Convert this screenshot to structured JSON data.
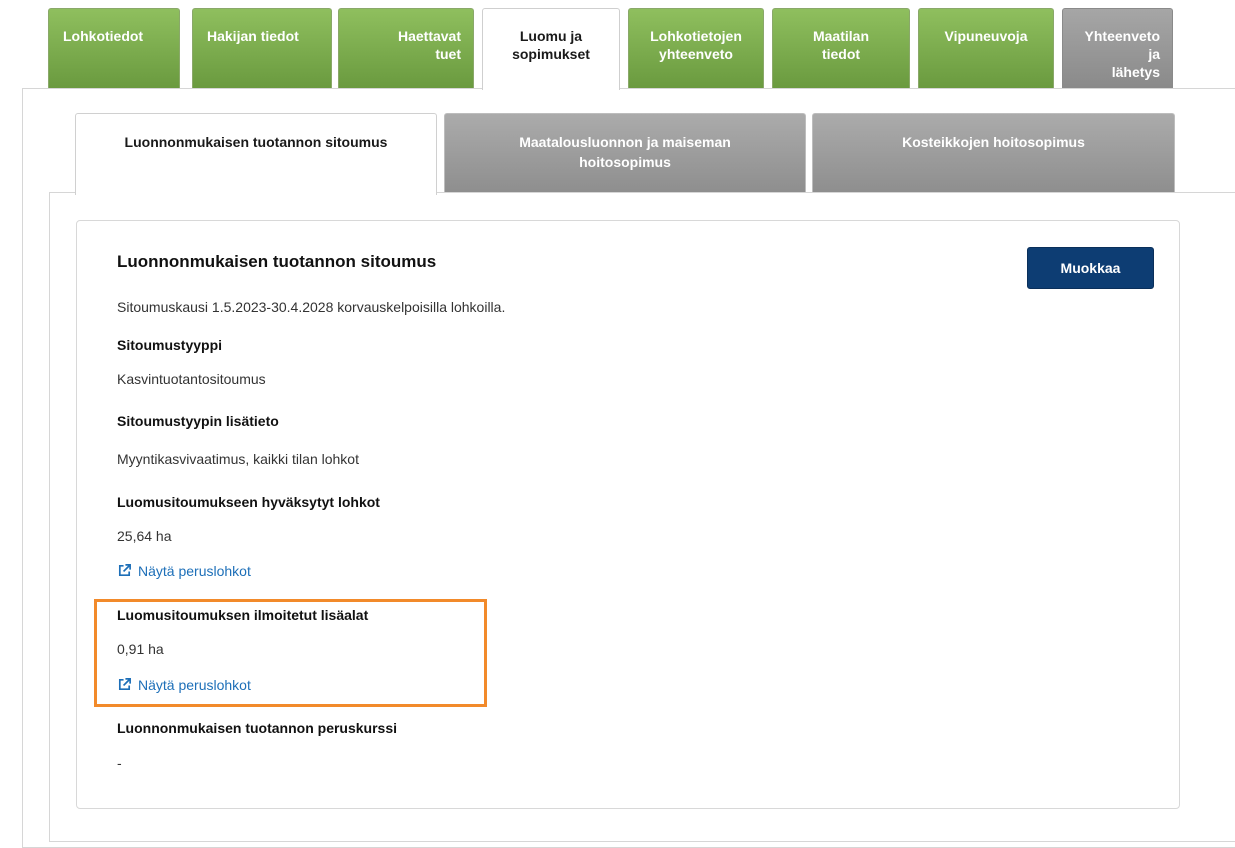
{
  "top_tabs": [
    {
      "label": "Lohkotiedot"
    },
    {
      "label": "Hakijan tiedot"
    },
    {
      "label_line1": "Haettavat",
      "label_line2": "tuet"
    },
    {
      "label_line1": "Luomu ja",
      "label_line2": "sopimukset"
    },
    {
      "label_line1": "Lohkotietojen",
      "label_line2": "yhteenveto"
    },
    {
      "label_line1": "Maatilan",
      "label_line2": "tiedot"
    },
    {
      "label": "Vipuneuvoja"
    },
    {
      "label_line1": "Yhteenveto ja",
      "label_line2": "lähetys"
    }
  ],
  "sub_tabs": [
    {
      "label": "Luonnonmukaisen tuotannon sitoumus"
    },
    {
      "label_line1": "Maatalousluonnon ja maiseman",
      "label_line2": "hoitosopimus"
    },
    {
      "label": "Kosteikkojen hoitosopimus"
    }
  ],
  "card": {
    "title": "Luonnonmukaisen tuotannon sitoumus",
    "edit_label": "Muokkaa",
    "period_text": "Sitoumuskausi 1.5.2023-30.4.2028 korvauskelpoisilla lohkoilla.",
    "type_label": "Sitoumustyyppi",
    "type_value": "Kasvintuotantositoumus",
    "type_info_label": "Sitoumustyypin lisätieto",
    "type_info_value": "Myyntikasvivaatimus, kaikki tilan lohkot",
    "accepted_label": "Luomusitoumukseen hyväksytyt lohkot",
    "accepted_value": "25,64 ha",
    "show_blocks_1": "Näytä peruslohkot",
    "additional_label": "Luomusitoumuksen ilmoitetut lisäalat",
    "additional_value": "0,91 ha",
    "show_blocks_2": "Näytä peruslohkot",
    "course_label": "Luonnonmukaisen tuotannon peruskurssi",
    "course_value": "-"
  },
  "colors": {
    "tab_green": "#7aab4c",
    "tab_gray": "#9a9a9a",
    "button_navy": "#0d3d73",
    "link_blue": "#1d6fb8",
    "highlight_orange": "#f28a2a"
  },
  "icons": {
    "external_link": "external-link-icon"
  }
}
